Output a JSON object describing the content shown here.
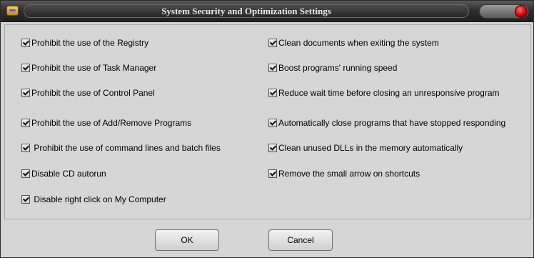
{
  "window": {
    "title": "System Security and Optimization Settings"
  },
  "left_options": [
    {
      "label": "Prohibit the use of the Registry",
      "checked": true
    },
    {
      "label": "Prohibit the use of Task Manager",
      "checked": true
    },
    {
      "label": "Prohibit the use of Control Panel",
      "checked": true
    },
    {
      "label": "Prohibit the use of Add/Remove Programs",
      "checked": true
    },
    {
      "label": " Prohibit the use of command lines and batch files",
      "checked": true
    },
    {
      "label": "Disable CD autorun",
      "checked": true
    },
    {
      "label": " Disable right click on My Computer",
      "checked": true
    }
  ],
  "right_options": [
    {
      "label": "Clean documents when exiting the system",
      "checked": true
    },
    {
      "label": "Boost programs' running speed",
      "checked": true
    },
    {
      "label": "Reduce wait time before closing an unresponsive program",
      "checked": true
    },
    {
      "label": "Automatically close programs that have stopped responding",
      "checked": true
    },
    {
      "label": "Clean unused DLLs in the memory automatically",
      "checked": true
    },
    {
      "label": "Remove the small arrow on shortcuts",
      "checked": true
    }
  ],
  "buttons": {
    "ok": "OK",
    "cancel": "Cancel"
  }
}
